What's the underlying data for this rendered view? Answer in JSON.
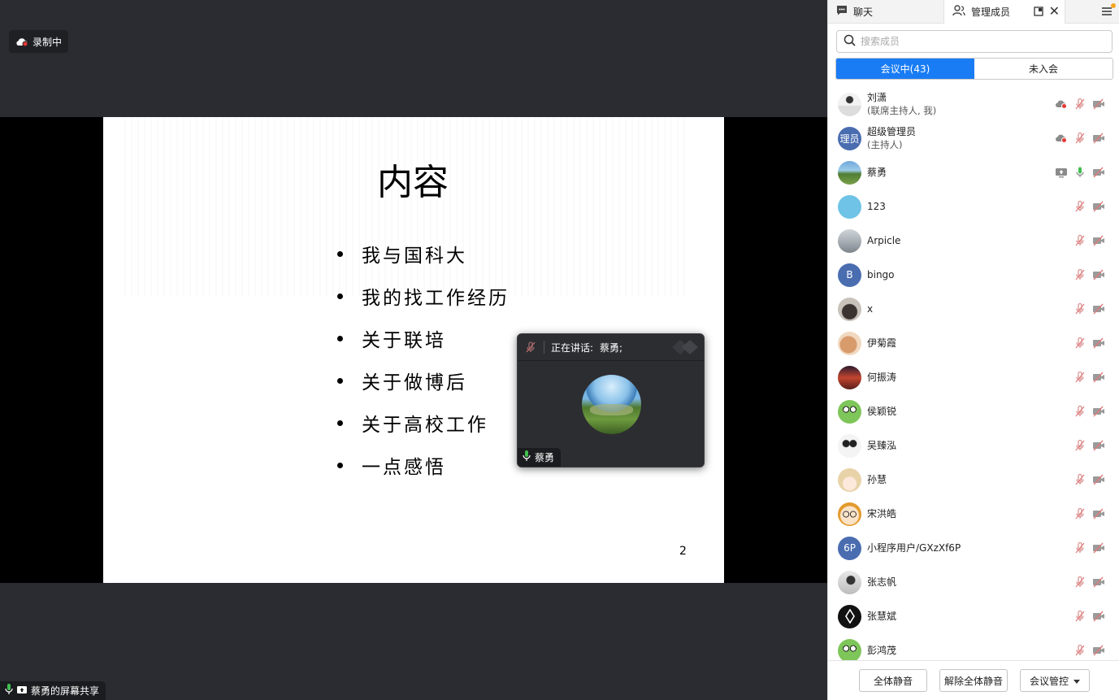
{
  "stage": {
    "recording_label": "录制中",
    "slide": {
      "title": "内容",
      "bullets": [
        "我与国科大",
        "我的找工作经历",
        "关于联培",
        "关于做博后",
        "关于高校工作",
        "一点感悟"
      ],
      "page_number": "2"
    },
    "speaker_card": {
      "speaking_label": "正在讲话:",
      "speaking_name": "蔡勇;",
      "name_tag": "蔡勇"
    },
    "share_label": "蔡勇的屏幕共享"
  },
  "panel": {
    "tabs": {
      "chat": "聊天",
      "members": "管理成员"
    },
    "search": {
      "placeholder": "搜索成员",
      "value": ""
    },
    "segments": {
      "in_meeting": "会议中(43)",
      "not_joined": "未入会"
    },
    "members": [
      {
        "name": "刘潇",
        "sub": "(联席主持人, 我)",
        "avatar": "photo-person",
        "cloud": true,
        "share": false,
        "mic": "muted",
        "cam": "off"
      },
      {
        "name": "超级管理员",
        "sub": "(主持人)",
        "avatar_text": "理员",
        "avatar_color": "#4a6db0",
        "cloud": true,
        "share": false,
        "mic": "muted",
        "cam": "off"
      },
      {
        "name": "蔡勇",
        "sub": "",
        "avatar": "photo-landscape",
        "cloud": false,
        "share": true,
        "mic": "active",
        "cam": "off"
      },
      {
        "name": "123",
        "sub": "",
        "avatar_color": "#6ec3e6",
        "cloud": false,
        "share": false,
        "mic": "muted",
        "cam": "off"
      },
      {
        "name": "Arpicle",
        "sub": "",
        "avatar": "photo-mist",
        "cloud": false,
        "share": false,
        "mic": "muted",
        "cam": "off"
      },
      {
        "name": "bingo",
        "sub": "",
        "avatar_text": "B",
        "avatar_color": "#4a6db0",
        "cloud": false,
        "share": false,
        "mic": "muted",
        "cam": "off"
      },
      {
        "name": "x",
        "sub": "",
        "avatar": "photo-dog",
        "cloud": false,
        "share": false,
        "mic": "muted",
        "cam": "off"
      },
      {
        "name": "伊菊霞",
        "sub": "",
        "avatar": "photo-pet",
        "cloud": false,
        "share": false,
        "mic": "muted",
        "cam": "off"
      },
      {
        "name": "何振涛",
        "sub": "",
        "avatar": "photo-sunset",
        "cloud": false,
        "share": false,
        "mic": "muted",
        "cam": "off"
      },
      {
        "name": "侯颖锐",
        "sub": "",
        "avatar": "cartoon-frog",
        "cloud": false,
        "share": false,
        "mic": "muted",
        "cam": "off"
      },
      {
        "name": "吴臻泓",
        "sub": "",
        "avatar": "photo-panda",
        "cloud": false,
        "share": false,
        "mic": "muted",
        "cam": "off"
      },
      {
        "name": "孙慧",
        "sub": "",
        "avatar": "cartoon-girl",
        "cloud": false,
        "share": false,
        "mic": "muted",
        "cam": "off"
      },
      {
        "name": "宋洪皓",
        "sub": "",
        "avatar": "cartoon-glasses",
        "cloud": false,
        "share": false,
        "mic": "muted",
        "cam": "off"
      },
      {
        "name": "小程序用户/GXzXf6P",
        "sub": "",
        "avatar_text": "6P",
        "avatar_color": "#4a6db0",
        "cloud": false,
        "share": false,
        "mic": "muted",
        "cam": "off"
      },
      {
        "name": "张志帆",
        "sub": "",
        "avatar": "photo-silhouette",
        "cloud": false,
        "share": false,
        "mic": "muted",
        "cam": "off"
      },
      {
        "name": "张慧斌",
        "sub": "",
        "avatar": "logo-diamond",
        "cloud": false,
        "share": false,
        "mic": "muted",
        "cam": "off"
      },
      {
        "name": "彭鸿茂",
        "sub": "",
        "avatar": "cartoon-frog",
        "cloud": false,
        "share": false,
        "mic": "muted",
        "cam": "off"
      }
    ],
    "footer": {
      "mute_all": "全体静音",
      "unmute_all": "解除全体静音",
      "meeting_control": "会议管控"
    }
  },
  "colors": {
    "accent": "#1a7cf5",
    "stage_bg": "#2b2c31",
    "muted_icon": "#d98a8a",
    "active_mic": "#3fbf4f",
    "recording_dot": "#e53935"
  }
}
